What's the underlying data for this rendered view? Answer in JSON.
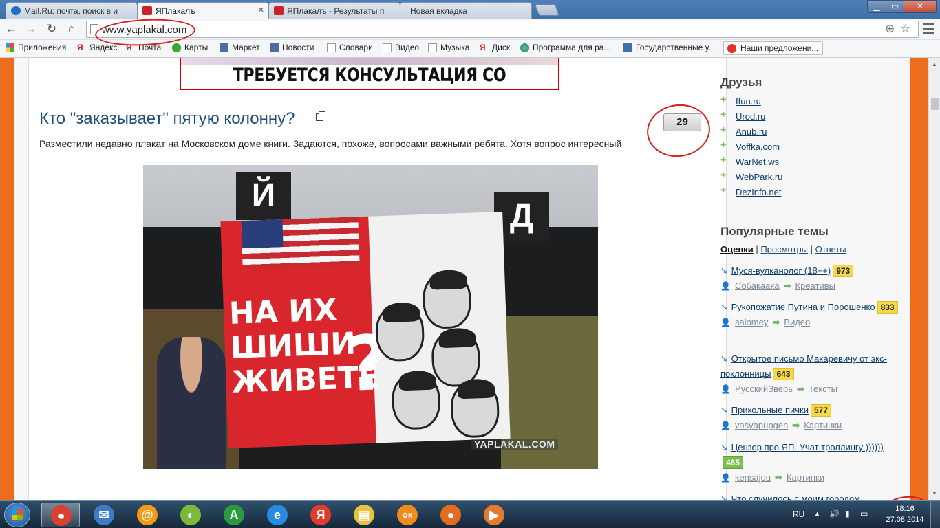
{
  "browser": {
    "tabs": [
      {
        "label": "Mail.Ru: почта, поиск в и",
        "icon": "mailru-icon",
        "active": false
      },
      {
        "label": "ЯПлакалъ",
        "icon": "yap-icon",
        "active": true
      },
      {
        "label": "ЯПлакалъ - Результаты п",
        "icon": "yap-icon",
        "active": false
      },
      {
        "label": "Новая вкладка",
        "icon": "",
        "active": false
      }
    ],
    "url": "www.yaplakal.com",
    "nav": {
      "back": "←",
      "forward": "→",
      "reload": "↻",
      "home": "⌂"
    }
  },
  "bookmarks": [
    {
      "label": "Приложения",
      "icon": "apps-grid-icon"
    },
    {
      "label": "Яндекс",
      "icon": "yandex-icon"
    },
    {
      "label": "Почта",
      "icon": "yandex-icon"
    },
    {
      "label": "Карты",
      "icon": "maps-icon"
    },
    {
      "label": "Маркет",
      "icon": "market-icon"
    },
    {
      "label": "Новости",
      "icon": "news-icon"
    },
    {
      "label": "Словари",
      "icon": "page-icon"
    },
    {
      "label": "Видео",
      "icon": "page-icon"
    },
    {
      "label": "Музыка",
      "icon": "page-icon"
    },
    {
      "label": "Диск",
      "icon": "yandex-icon"
    },
    {
      "label": "Программа для ра...",
      "icon": "globe-icon"
    },
    {
      "label": "Государственные у...",
      "icon": "gov-icon"
    },
    {
      "label": "Наши предложени...",
      "icon": "offer-icon"
    }
  ],
  "page": {
    "banner_text": "ТРЕБУЕТСЯ КОНСУЛЬТАЦИЯ СО СПЕЦИАЛИСТОМ",
    "post": {
      "title": "Кто \"заказывает\" пятую колонну?",
      "comments": "29",
      "text": "Разместили недавно плакат на Московском доме книги. Задаются, похоже, вопросами важными ребята. Хотя вопрос интересный",
      "photo": {
        "sign_left": "Й",
        "sign_right": "Д",
        "poster_lines": [
          "НА ИХ",
          "ШИШИ",
          "ЖИВЕТЕ"
        ],
        "watermark": "YAPLAKAL.COM"
      }
    }
  },
  "sidebar": {
    "friends_title": "Друзья",
    "friends": [
      "Ifun.ru",
      "Urod.ru",
      "Anub.ru",
      "Voffka.com",
      "WarNet.ws",
      "WebPark.ru",
      "DezInfo.net"
    ],
    "popular_title": "Популярные темы",
    "popular_tabs": [
      "Оценки",
      "Просмотры",
      "Ответы"
    ],
    "popular": [
      {
        "title": "Муся-вулканолог (18++)",
        "score": "973",
        "user": "Собакаака",
        "category": "Креативы"
      },
      {
        "title": "Рукопожатие Путина и Порошенко",
        "score": "833",
        "user": "salomey",
        "category": "Видео"
      },
      {
        "title": "Открытое письмо Макаревичу от экс-поклонницы",
        "score": "643",
        "user": "РусскийЗверь",
        "category": "Тексты"
      },
      {
        "title": "Прикольные пички",
        "score": "577",
        "user": "vasyapupgen",
        "category": "Картинки"
      },
      {
        "title": "Цензор про ЯП. Учат троллингу ))))))",
        "score": "465",
        "user": "kensajou",
        "category": "Картинки"
      },
      {
        "title": "Что случилось с моим городом",
        "score": "",
        "user": "",
        "category": ""
      }
    ]
  },
  "taskbar": {
    "apps": [
      {
        "name": "chrome",
        "glyph": "●",
        "color": "#d8402f",
        "active": true
      },
      {
        "name": "mail",
        "glyph": "✉",
        "color": "#3b7bc8",
        "active": false
      },
      {
        "name": "mailru-agent",
        "glyph": "@",
        "color": "#f59a16",
        "active": false
      },
      {
        "name": "disk-app",
        "glyph": "◐",
        "color": "#7cb83a",
        "active": false
      },
      {
        "name": "font-app",
        "glyph": "A",
        "color": "#2b9a3b",
        "active": false
      },
      {
        "name": "internet-explorer",
        "glyph": "e",
        "color": "#2a8ae0",
        "active": false
      },
      {
        "name": "yandex-browser",
        "glyph": "Я",
        "color": "#e23b2e",
        "active": false
      },
      {
        "name": "file-explorer",
        "glyph": "▤",
        "color": "#e8c23c",
        "active": false
      },
      {
        "name": "odnoklassniki",
        "glyph": "ок",
        "color": "#f08a1c",
        "active": false
      },
      {
        "name": "firefox",
        "glyph": "●",
        "color": "#e56b1f",
        "active": false
      },
      {
        "name": "media-player",
        "glyph": "▶",
        "color": "#e8792a",
        "active": false
      }
    ],
    "language": "RU",
    "time": "18:16",
    "date": "27.08.2014"
  }
}
